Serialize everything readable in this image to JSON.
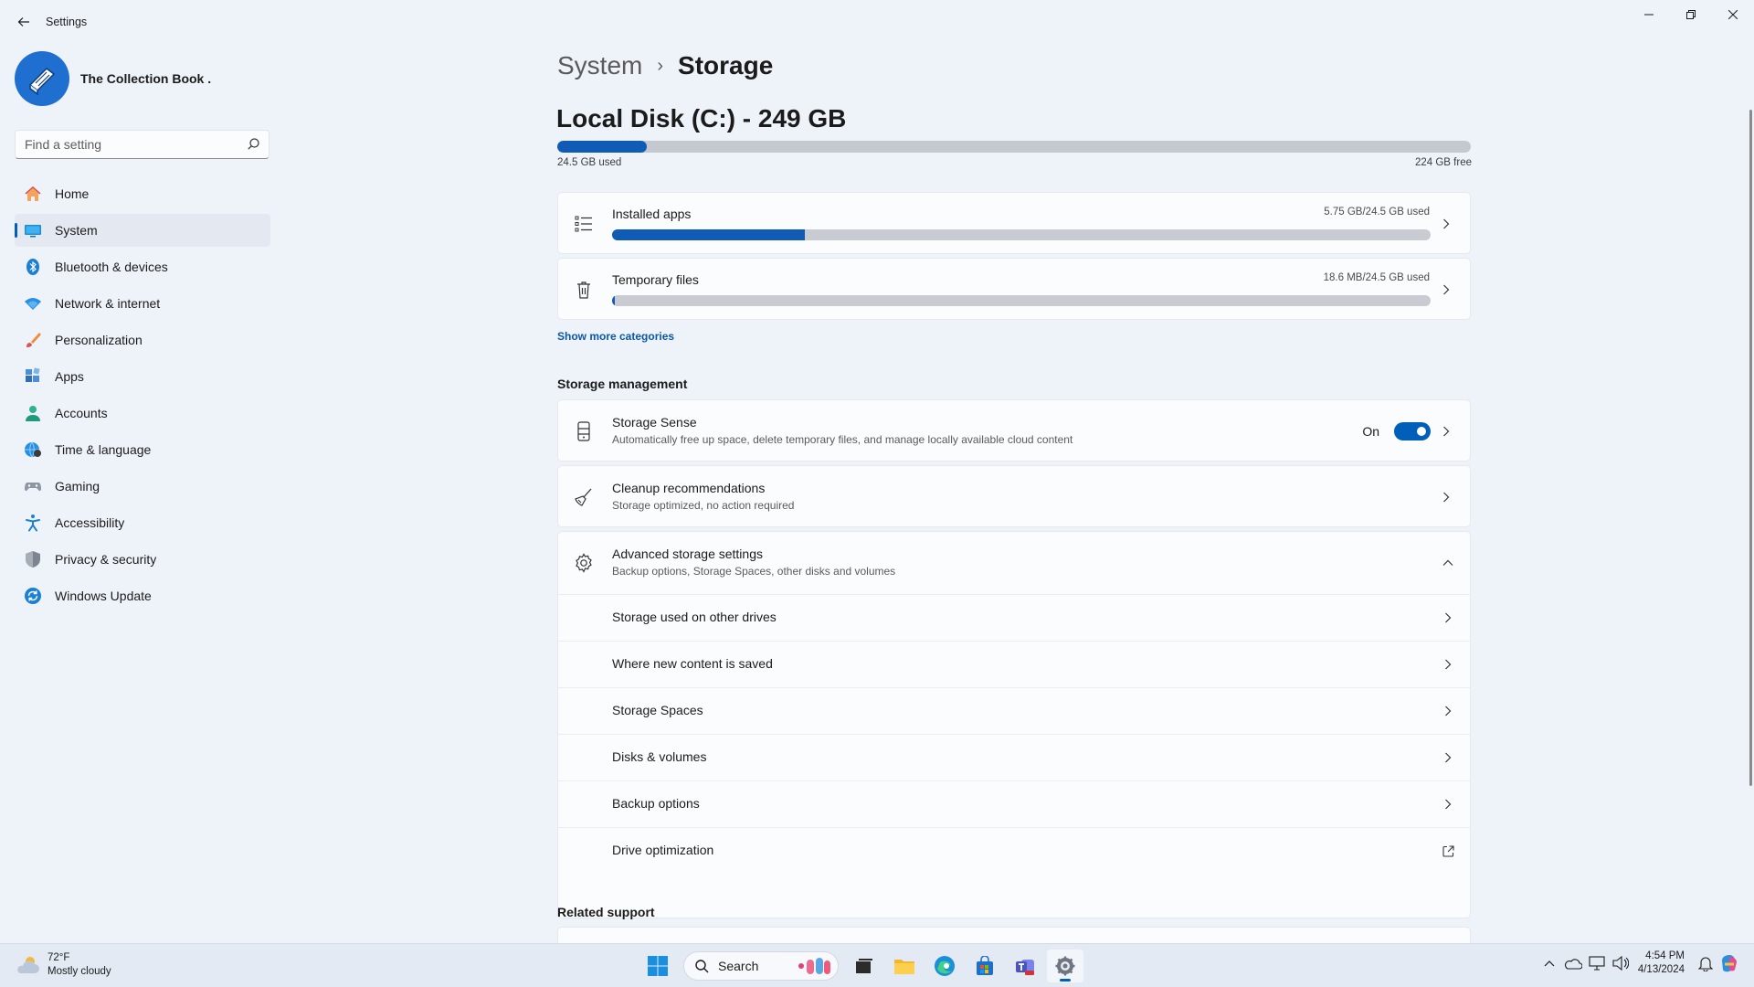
{
  "window": {
    "title": "Settings",
    "back_icon": "arrow-left-icon",
    "controls": [
      "minimize-icon",
      "restore-icon",
      "close-icon"
    ]
  },
  "profile": {
    "name": "The Collection Book ."
  },
  "search": {
    "placeholder": "Find a setting"
  },
  "nav": {
    "items": [
      {
        "label": "Home",
        "icon": "home-icon",
        "active": false
      },
      {
        "label": "System",
        "icon": "monitor-icon",
        "active": true
      },
      {
        "label": "Bluetooth & devices",
        "icon": "bluetooth-icon",
        "active": false
      },
      {
        "label": "Network & internet",
        "icon": "wifi-icon",
        "active": false
      },
      {
        "label": "Personalization",
        "icon": "brush-icon",
        "active": false
      },
      {
        "label": "Apps",
        "icon": "apps-icon",
        "active": false
      },
      {
        "label": "Accounts",
        "icon": "person-icon",
        "active": false
      },
      {
        "label": "Time & language",
        "icon": "globe-clock-icon",
        "active": false
      },
      {
        "label": "Gaming",
        "icon": "gamepad-icon",
        "active": false
      },
      {
        "label": "Accessibility",
        "icon": "accessibility-icon",
        "active": false
      },
      {
        "label": "Privacy & security",
        "icon": "shield-icon",
        "active": false
      },
      {
        "label": "Windows Update",
        "icon": "update-icon",
        "active": false
      }
    ]
  },
  "breadcrumb": {
    "parent": "System",
    "separator": "›",
    "current": "Storage"
  },
  "disk": {
    "title": "Local Disk (C:) - 249 GB",
    "used_label": "24.5 GB used",
    "free_label": "224 GB free",
    "used_fraction": 0.098
  },
  "categories": [
    {
      "title": "Installed apps",
      "usage": "5.75 GB/24.5 GB used",
      "fraction": 0.235,
      "icon": "list-icon"
    },
    {
      "title": "Temporary files",
      "usage": "18.6 MB/24.5 GB used",
      "fraction": 0.003,
      "icon": "trash-icon"
    }
  ],
  "show_more": "Show more categories",
  "storage_management": {
    "heading": "Storage management",
    "storage_sense": {
      "title": "Storage Sense",
      "subtitle": "Automatically free up space, delete temporary files, and manage locally available cloud content",
      "toggle_label": "On",
      "toggle_on": true
    },
    "cleanup": {
      "title": "Cleanup recommendations",
      "subtitle": "Storage optimized, no action required"
    },
    "advanced": {
      "title": "Advanced storage settings",
      "subtitle": "Backup options, Storage Spaces, other disks and volumes",
      "rows": [
        {
          "label": "Storage used on other drives",
          "icon": "chevron-right-icon"
        },
        {
          "label": "Where new content is saved",
          "icon": "chevron-right-icon"
        },
        {
          "label": "Storage Spaces",
          "icon": "chevron-right-icon"
        },
        {
          "label": "Disks & volumes",
          "icon": "chevron-right-icon"
        },
        {
          "label": "Backup options",
          "icon": "chevron-right-icon"
        },
        {
          "label": "Drive optimization",
          "icon": "external-link-icon"
        }
      ]
    }
  },
  "related_support": {
    "heading": "Related support"
  },
  "taskbar": {
    "weather": {
      "temp": "72°F",
      "condition": "Mostly cloudy"
    },
    "search_label": "Search",
    "apps": [
      "start-icon",
      "search-icon",
      "task-view-icon",
      "file-explorer-icon",
      "edge-icon",
      "store-icon",
      "teams-icon",
      "settings-icon"
    ],
    "clock": {
      "time": "4:54 PM",
      "date": "4/13/2024"
    }
  },
  "colors": {
    "accent": "#005fb8",
    "bar_fill": "#0f5bb5",
    "bar_track": "#c4c9d0",
    "background": "#eef3fa"
  }
}
